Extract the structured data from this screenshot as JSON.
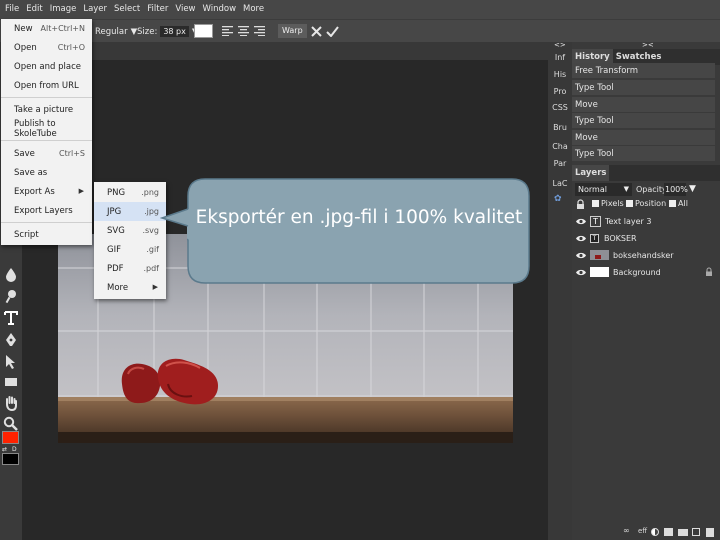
{
  "menubar": {
    "items": [
      {
        "label": "File"
      },
      {
        "label": "Edit"
      },
      {
        "label": "Image"
      },
      {
        "label": "Layer"
      },
      {
        "label": "Select"
      },
      {
        "label": "Filter"
      },
      {
        "label": "View"
      },
      {
        "label": "Window"
      },
      {
        "label": "More"
      }
    ]
  },
  "options": {
    "font_style": "Regular",
    "size_label": "Size:",
    "size_value": "38 px",
    "warp_label": "Warp"
  },
  "file_menu": {
    "items": [
      {
        "label": "New",
        "shortcut": "Alt+Ctrl+N"
      },
      {
        "label": "Open",
        "shortcut": "Ctrl+O"
      },
      {
        "label": "Open and place",
        "shortcut": ""
      },
      {
        "label": "Open from URL",
        "shortcut": ""
      },
      {
        "label": "Take a picture",
        "shortcut": ""
      },
      {
        "label": "Publish to SkoleTube",
        "shortcut": ""
      },
      {
        "label": "Save",
        "shortcut": "Ctrl+S"
      },
      {
        "label": "Save as",
        "shortcut": ""
      },
      {
        "label": "Export As",
        "shortcut": ""
      },
      {
        "label": "Export Layers",
        "shortcut": ""
      },
      {
        "label": "Script",
        "shortcut": ""
      }
    ]
  },
  "export_menu": {
    "items": [
      {
        "label": "PNG",
        "ext": ".png"
      },
      {
        "label": "JPG",
        "ext": ".jpg"
      },
      {
        "label": "SVG",
        "ext": ".svg"
      },
      {
        "label": "GIF",
        "ext": ".gif"
      },
      {
        "label": "PDF",
        "ext": ".pdf"
      },
      {
        "label": "More",
        "ext": ""
      }
    ]
  },
  "callout": {
    "text": "Eksportér en .jpg-fil i 100% kvalitet"
  },
  "mini_panel": {
    "items": [
      {
        "label": "Inf"
      },
      {
        "label": "His"
      },
      {
        "label": "Pro"
      },
      {
        "label": "CSS"
      },
      {
        "label": "Bru"
      },
      {
        "label": "Cha"
      },
      {
        "label": "Par"
      },
      {
        "label": "LaC"
      }
    ]
  },
  "history_panel": {
    "tabs": [
      {
        "label": "History"
      },
      {
        "label": "Swatches"
      }
    ],
    "items": [
      {
        "label": "Free Transform"
      },
      {
        "label": "Type Tool"
      },
      {
        "label": "Move"
      },
      {
        "label": "Type Tool"
      },
      {
        "label": "Move"
      },
      {
        "label": "Type Tool"
      }
    ]
  },
  "layers_panel": {
    "title": "Layers",
    "blend_mode": "Normal",
    "opacity_label": "Opacity:",
    "opacity_value": "100%",
    "lock_options": [
      {
        "label": "Pixels"
      },
      {
        "label": "Position"
      },
      {
        "label": "All"
      }
    ],
    "layers": [
      {
        "name": "Text layer 3"
      },
      {
        "name": "BOKSER"
      },
      {
        "name": "boksehandsker"
      },
      {
        "name": "Background"
      }
    ],
    "footer_label": "eff"
  },
  "colors": {
    "foreground": "#ff2200",
    "background": "#000000",
    "callout_fill": "#8aa3b0",
    "callout_stroke": "#5b7a8c"
  }
}
